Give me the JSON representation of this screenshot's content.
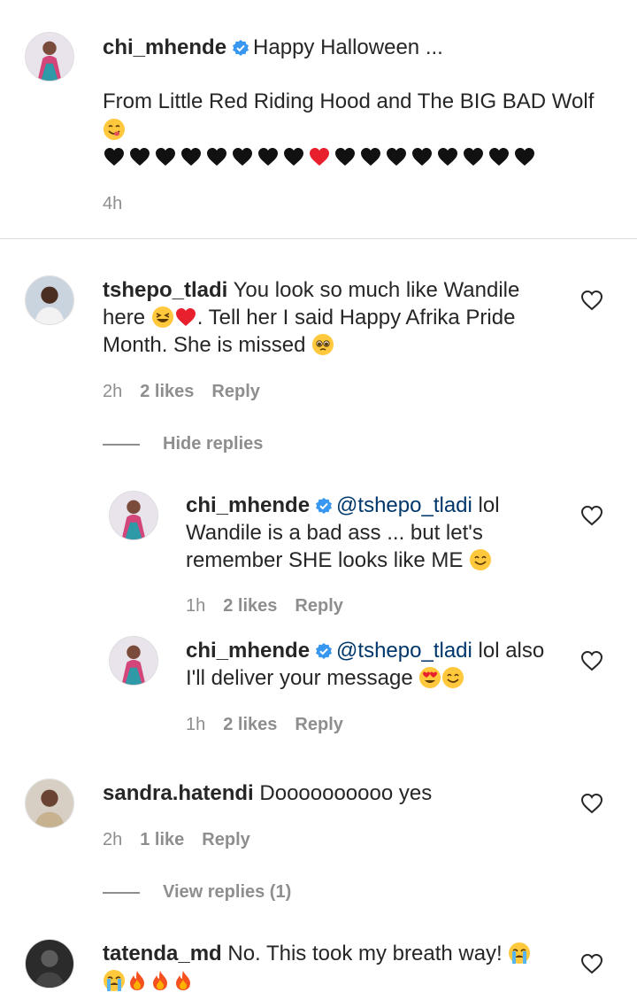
{
  "caption": {
    "username": "chi_mhende",
    "text_1": "Happy Halloween ...",
    "text_2": "From Little Red Riding Hood and The BIG BAD Wolf",
    "time": "4h"
  },
  "comments": [
    {
      "username": "tshepo_tladi",
      "text_1": "You look so much like Wandile",
      "text_2": "here",
      "text_3": ". Tell her I said Happy Afrika Pride",
      "text_4": "Month. She is missed",
      "time": "2h",
      "likes": "2 likes",
      "reply": "Reply",
      "toggle": "Hide replies"
    },
    {
      "username": "chi_mhende",
      "mention": "@tshepo_tladi",
      "text_1": "lol",
      "text_2": "Wandile is a bad ass ... but let's",
      "text_3": "remember SHE looks like ME",
      "time": "1h",
      "likes": "2 likes",
      "reply": "Reply"
    },
    {
      "username": "chi_mhende",
      "mention": "@tshepo_tladi",
      "text_1": "lol also",
      "text_2": "I'll deliver your message",
      "time": "1h",
      "likes": "2 likes",
      "reply": "Reply"
    },
    {
      "username": "sandra.hatendi",
      "text_1": "Doooooooooo yes",
      "time": "2h",
      "likes": "1 like",
      "reply": "Reply",
      "toggle": "View replies (1)"
    },
    {
      "username": "tatenda_md",
      "text_1": "No. This took my breath way!"
    }
  ],
  "colors": {
    "text": "#262626",
    "meta": "#8e8e8e",
    "mention": "#00376b",
    "verified": "#3897f0"
  }
}
